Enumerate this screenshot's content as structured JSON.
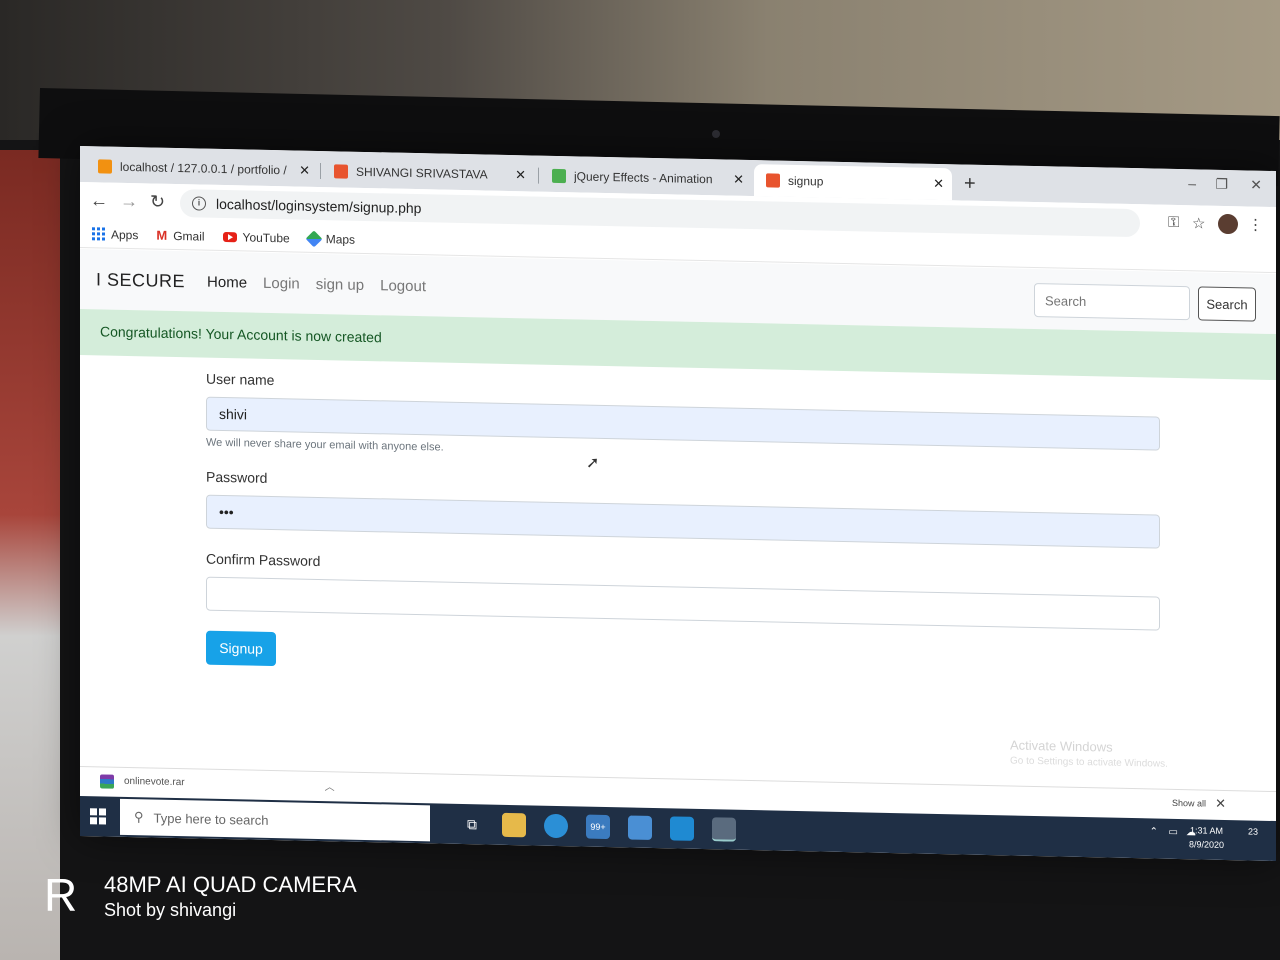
{
  "browser": {
    "tabs": [
      {
        "label": "localhost / 127.0.0.1 / portfolio /",
        "favicon_color": "#f29111"
      },
      {
        "label": "SHIVANGI SRIVASTAVA",
        "favicon_color": "#e8542e"
      },
      {
        "label": "jQuery Effects - Animation",
        "favicon_color": "#4caf50"
      },
      {
        "label": "signup",
        "favicon_color": "#e8542e",
        "active": true
      }
    ],
    "url": "localhost/loginsystem/signup.php",
    "bookmarks": [
      "Apps",
      "Gmail",
      "YouTube",
      "Maps"
    ]
  },
  "site": {
    "brand": "I SECURE",
    "nav": [
      "Home",
      "Login",
      "sign up",
      "Logout"
    ],
    "search_placeholder": "Search",
    "search_button": "Search"
  },
  "alert": {
    "message": "Congratulations! Your Account is now created",
    "color": "#d4edda"
  },
  "form": {
    "username_label": "User name",
    "username_value": "shivi",
    "username_help": "We will never share your email with anyone else.",
    "password_label": "Password",
    "password_value": "•••",
    "confirm_label": "Confirm Password",
    "confirm_value": "",
    "submit_label": "Signup",
    "submit_color": "#17a2e8"
  },
  "watermark": {
    "title": "Activate Windows",
    "subtitle": "Go to Settings to activate Windows."
  },
  "downloads": {
    "file": "onlinevote.rar",
    "show_all": "Show all"
  },
  "taskbar": {
    "search_placeholder": "Type here to search",
    "mail_badge": "99+",
    "time": "1:31 AM",
    "date": "8/9/2020",
    "notification_count": "23"
  },
  "camera": {
    "title": "48MP AI QUAD CAMERA",
    "subtitle": "Shot by shivangi"
  }
}
